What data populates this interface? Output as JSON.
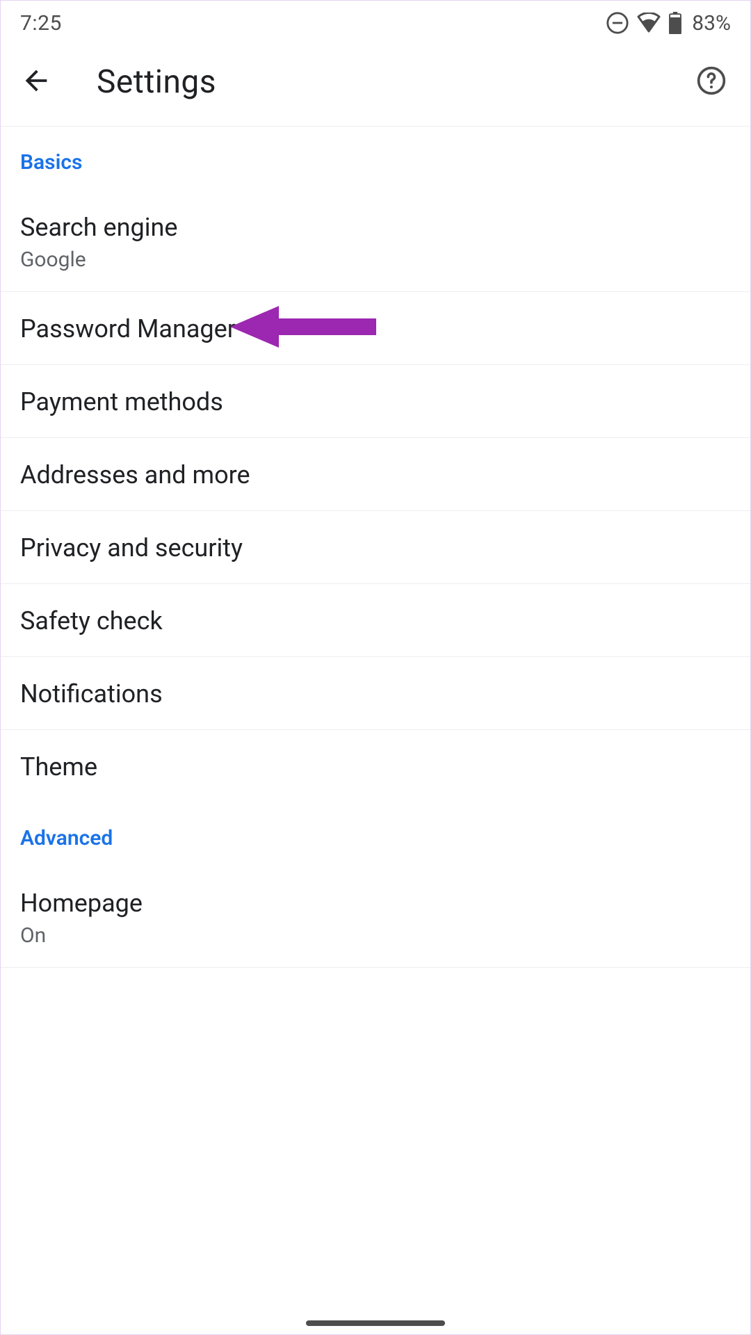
{
  "status": {
    "time": "7:25",
    "battery_pct": "83%"
  },
  "header": {
    "title": "Settings"
  },
  "sections": {
    "basics": {
      "label": "Basics",
      "items": {
        "search_engine": {
          "title": "Search engine",
          "sub": "Google"
        },
        "password_manager": {
          "title": "Password Manager"
        },
        "payment_methods": {
          "title": "Payment methods"
        },
        "addresses": {
          "title": "Addresses and more"
        },
        "privacy": {
          "title": "Privacy and security"
        },
        "safety_check": {
          "title": "Safety check"
        },
        "notifications": {
          "title": "Notifications"
        },
        "theme": {
          "title": "Theme"
        }
      }
    },
    "advanced": {
      "label": "Advanced",
      "items": {
        "homepage": {
          "title": "Homepage",
          "sub": "On"
        }
      }
    }
  },
  "annotation": {
    "arrow_color": "#9c27b0"
  }
}
